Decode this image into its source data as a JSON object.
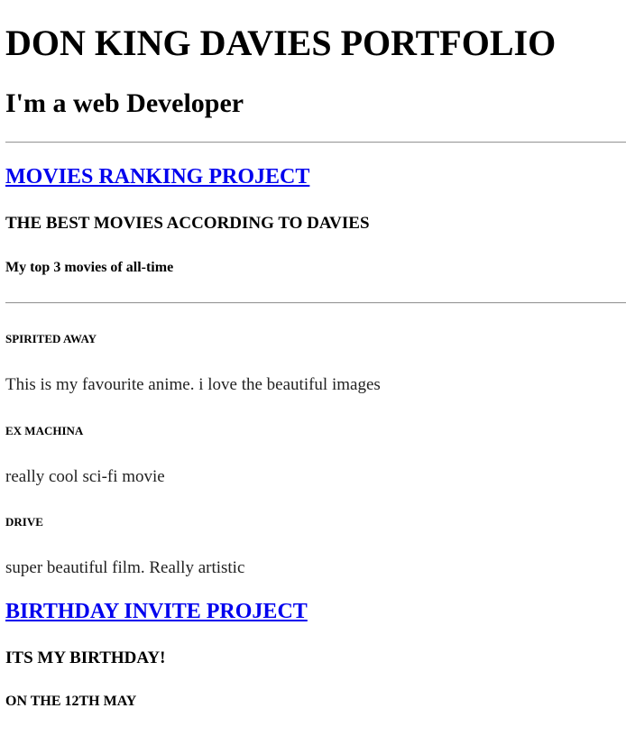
{
  "header": {
    "title": "DON KING DAVIES PORTFOLIO",
    "subtitle": "I'm a web Developer"
  },
  "projects": [
    {
      "link_label": "MOVIES RANKING PROJECT",
      "heading": "THE BEST MOVIES ACCORDING TO DAVIES",
      "subheading": "My top 3 movies of all-time",
      "movies": [
        {
          "title": "SPIRITED AWAY",
          "description": "This is my favourite anime. i love the beautiful images"
        },
        {
          "title": "EX MACHINA",
          "description": "really cool sci-fi movie"
        },
        {
          "title": "DRIVE",
          "description": "super beautiful film. Really artistic"
        }
      ]
    },
    {
      "link_label": "BIRTHDAY INVITE PROJECT",
      "heading": "ITS MY BIRTHDAY!",
      "subheading": "ON THE 12TH MAY"
    }
  ],
  "colors": {
    "link": "#0000ee",
    "text": "#000000",
    "rule": "#9a9a9a"
  }
}
